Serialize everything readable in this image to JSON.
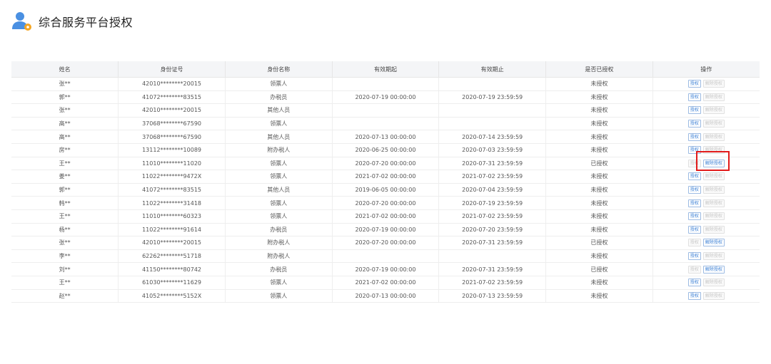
{
  "page": {
    "title": "综合服务平台授权"
  },
  "table": {
    "headers": [
      "姓名",
      "身份证号",
      "身份名称",
      "有效期起",
      "有效期止",
      "是否已授权",
      "操作"
    ],
    "authorize_label": "授权",
    "revoke_label": "解除授权",
    "rows": [
      {
        "name": "张**",
        "id": "42010********20015",
        "role": "领票人",
        "start": "",
        "end": "",
        "status": "未授权",
        "authorized": false
      },
      {
        "name": "郭**",
        "id": "41072********83515",
        "role": "办税员",
        "start": "2020-07-19 00:00:00",
        "end": "2020-07-19 23:59:59",
        "status": "未授权",
        "authorized": false
      },
      {
        "name": "张**",
        "id": "42010********20015",
        "role": "其他人员",
        "start": "",
        "end": "",
        "status": "未授权",
        "authorized": false
      },
      {
        "name": "高**",
        "id": "37068********67590",
        "role": "领票人",
        "start": "",
        "end": "",
        "status": "未授权",
        "authorized": false
      },
      {
        "name": "高**",
        "id": "37068********67590",
        "role": "其他人员",
        "start": "2020-07-13 00:00:00",
        "end": "2020-07-14 23:59:59",
        "status": "未授权",
        "authorized": false
      },
      {
        "name": "房**",
        "id": "13112********10089",
        "role": "附办税人",
        "start": "2020-06-25 00:00:00",
        "end": "2020-07-03 23:59:59",
        "status": "未授权",
        "authorized": false
      },
      {
        "name": "王**",
        "id": "11010********11020",
        "role": "领票人",
        "start": "2020-07-20 00:00:00",
        "end": "2020-07-31 23:59:59",
        "status": "已授权",
        "authorized": true
      },
      {
        "name": "姜**",
        "id": "11022********9472X",
        "role": "领票人",
        "start": "2021-07-02 00:00:00",
        "end": "2021-07-02 23:59:59",
        "status": "未授权",
        "authorized": false
      },
      {
        "name": "郭**",
        "id": "41072********83515",
        "role": "其他人员",
        "start": "2019-06-05 00:00:00",
        "end": "2020-07-04 23:59:59",
        "status": "未授权",
        "authorized": false
      },
      {
        "name": "韩**",
        "id": "11022********31418",
        "role": "领票人",
        "start": "2020-07-20 00:00:00",
        "end": "2020-07-19 23:59:59",
        "status": "未授权",
        "authorized": false
      },
      {
        "name": "王**",
        "id": "11010********60323",
        "role": "领票人",
        "start": "2021-07-02 00:00:00",
        "end": "2021-07-02 23:59:59",
        "status": "未授权",
        "authorized": false
      },
      {
        "name": "杨**",
        "id": "11022********91614",
        "role": "办税员",
        "start": "2020-07-19 00:00:00",
        "end": "2020-07-20 23:59:59",
        "status": "未授权",
        "authorized": false
      },
      {
        "name": "张**",
        "id": "42010********20015",
        "role": "附办税人",
        "start": "2020-07-20 00:00:00",
        "end": "2020-07-31 23:59:59",
        "status": "已授权",
        "authorized": true
      },
      {
        "name": "李**",
        "id": "62262********51718",
        "role": "附办税人",
        "start": "",
        "end": "",
        "status": "未授权",
        "authorized": false
      },
      {
        "name": "刘**",
        "id": "41150********80742",
        "role": "办税员",
        "start": "2020-07-19 00:00:00",
        "end": "2020-07-31 23:59:59",
        "status": "已授权",
        "authorized": true
      },
      {
        "name": "王**",
        "id": "61030********11629",
        "role": "领票人",
        "start": "2021-07-02 00:00:00",
        "end": "2021-07-02 23:59:59",
        "status": "未授权",
        "authorized": false
      },
      {
        "name": "赵**",
        "id": "41052********5152X",
        "role": "领票人",
        "start": "2020-07-13 00:00:00",
        "end": "2020-07-13 23:59:59",
        "status": "未授权",
        "authorized": false
      }
    ]
  },
  "colors": {
    "accent": "#3a7fd5",
    "highlight": "#e21b1b",
    "icon_blue": "#4a90e2",
    "icon_badge": "#f5a623"
  }
}
